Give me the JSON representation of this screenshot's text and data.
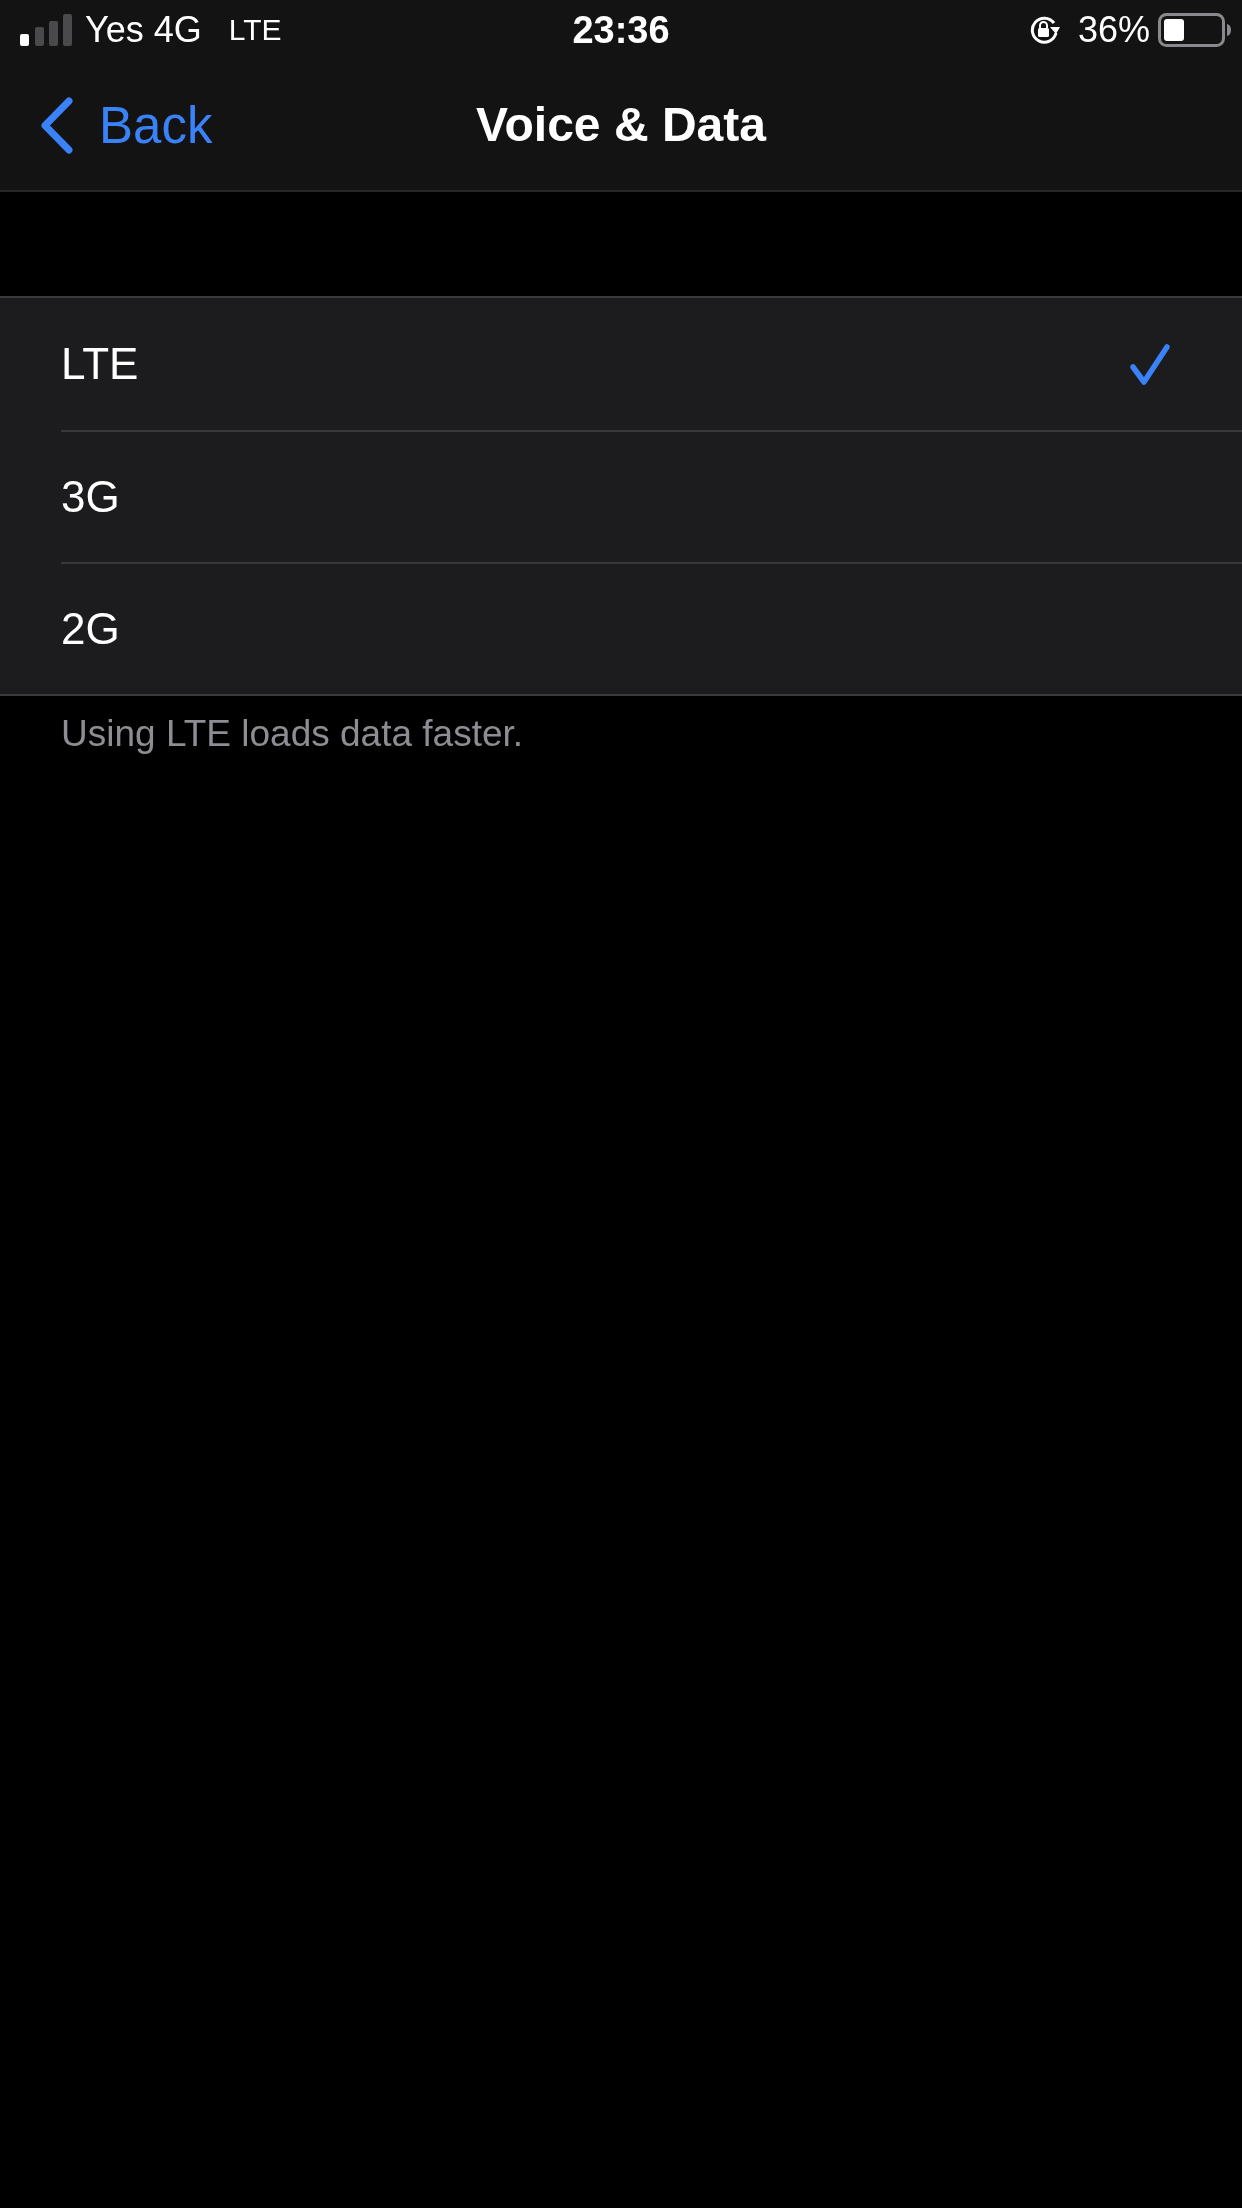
{
  "status_bar": {
    "carrier": "Yes 4G",
    "network": "LTE",
    "time": "23:36",
    "battery_percent": "36%"
  },
  "nav": {
    "back_label": "Back",
    "title": "Voice & Data"
  },
  "options": [
    {
      "label": "LTE",
      "selected": true
    },
    {
      "label": "3G",
      "selected": false
    },
    {
      "label": "2G",
      "selected": false
    }
  ],
  "footer": "Using LTE loads data faster."
}
